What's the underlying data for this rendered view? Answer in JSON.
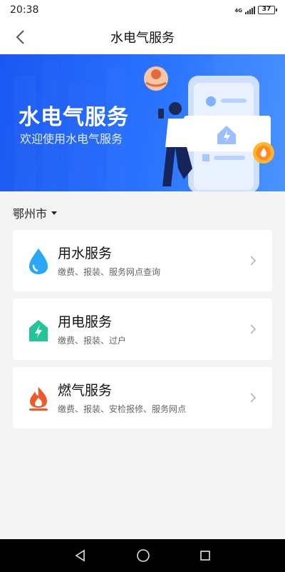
{
  "status_bar": {
    "time": "20:38",
    "network": "4G",
    "battery": "37"
  },
  "nav": {
    "title": "水电气服务"
  },
  "banner": {
    "title": "水电气服务",
    "subtitle": "欢迎使用水电气服务"
  },
  "city": {
    "name": "鄂州市"
  },
  "services": [
    {
      "title": "用水服务",
      "subtitle": "缴费、报装、服务网点查询",
      "icon": "water-drop-icon"
    },
    {
      "title": "用电服务",
      "subtitle": "缴费、报装、过户",
      "icon": "electricity-icon"
    },
    {
      "title": "燃气服务",
      "subtitle": "缴费、报装、安检报修、服务网点",
      "icon": "gas-flame-icon"
    }
  ],
  "colors": {
    "brand_blue": "#1b57f2",
    "water": "#2aa7f5",
    "electric": "#23c49a",
    "gas": "#f05a2b"
  }
}
